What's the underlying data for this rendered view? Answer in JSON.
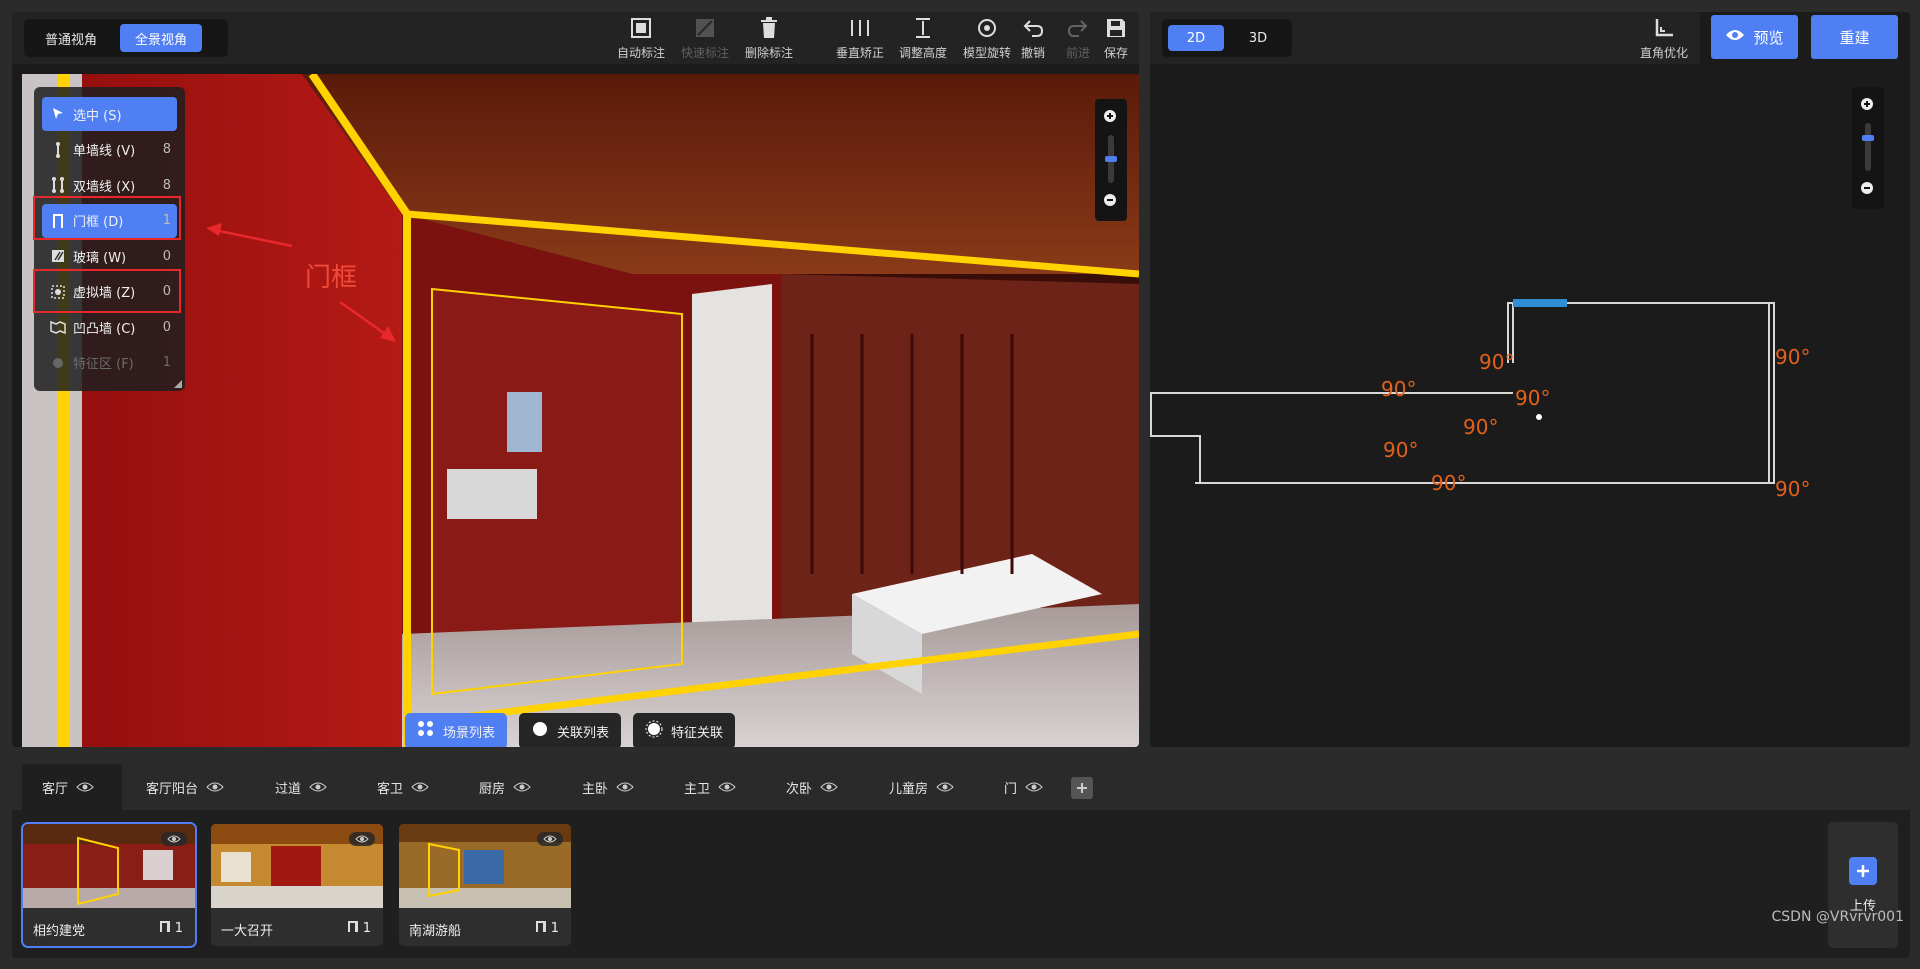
{
  "view_toggle": {
    "normal": "普通视角",
    "panorama": "全景视角",
    "active": "panorama"
  },
  "toolbar": [
    {
      "label": "自动标注",
      "icon": "auto-mark-icon",
      "enabled": true
    },
    {
      "label": "快速标注",
      "icon": "quick-mark-icon",
      "enabled": false
    },
    {
      "label": "删除标注",
      "icon": "trash-icon",
      "enabled": true
    },
    {
      "label": "垂直矫正",
      "icon": "vertical-correct-icon",
      "enabled": true
    },
    {
      "label": "调整高度",
      "icon": "adjust-height-icon",
      "enabled": true
    },
    {
      "label": "模型旋转",
      "icon": "rotate-icon",
      "enabled": true
    },
    {
      "label": "撤销",
      "icon": "undo-icon",
      "enabled": true
    },
    {
      "label": "前进",
      "icon": "redo-icon",
      "enabled": false
    },
    {
      "label": "保存",
      "icon": "save-icon",
      "enabled": true
    }
  ],
  "palette": [
    {
      "label": "选中 (S)",
      "count": "",
      "icon": "cursor-icon",
      "active": true,
      "enabled": true
    },
    {
      "label": "单墙线 (V)",
      "count": "8",
      "icon": "single-wall-icon",
      "active": false,
      "enabled": true
    },
    {
      "label": "双墙线 (X)",
      "count": "8",
      "icon": "double-wall-icon",
      "active": false,
      "enabled": true
    },
    {
      "label": "门框 (D)",
      "count": "1",
      "icon": "door-frame-icon",
      "active": true,
      "enabled": true
    },
    {
      "label": "玻璃 (W)",
      "count": "0",
      "icon": "glass-icon",
      "active": false,
      "enabled": true
    },
    {
      "label": "虚拟墙 (Z)",
      "count": "0",
      "icon": "virtual-wall-icon",
      "active": false,
      "enabled": true
    },
    {
      "label": "凹凸墙 (C)",
      "count": "0",
      "icon": "bump-wall-icon",
      "active": false,
      "enabled": true
    },
    {
      "label": "特征区 (F)",
      "count": "1",
      "icon": "feature-area-icon",
      "active": false,
      "enabled": false
    }
  ],
  "annotation": {
    "label": "门框"
  },
  "pano_buttons": [
    {
      "label": "场景列表",
      "icon": "scene-list-icon",
      "active": true
    },
    {
      "label": "关联列表",
      "icon": "link-list-icon",
      "active": false
    },
    {
      "label": "特征关联",
      "icon": "feature-link-icon",
      "active": false
    }
  ],
  "right": {
    "dim_toggle": {
      "two_d": "2D",
      "three_d": "3D",
      "active": "2D"
    },
    "optimize_label": "直角优化",
    "preview_label": "预览",
    "rebuild_label": "重建"
  },
  "floorplan": {
    "angle_labels": [
      "90°",
      "90°",
      "90°",
      "90°",
      "90°",
      "90°",
      "90°",
      "90°"
    ]
  },
  "room_tabs": [
    "客厅",
    "客厅阳台",
    "过道",
    "客卫",
    "厨房",
    "主卧",
    "主卫",
    "次卧",
    "儿童房",
    "门"
  ],
  "active_tab": "客厅",
  "scenes": [
    {
      "name": "相约建党",
      "count": "1",
      "active": true
    },
    {
      "name": "一大召开",
      "count": "1",
      "active": false
    },
    {
      "name": "南湖游船",
      "count": "1",
      "active": false
    }
  ],
  "upload_label": "上传",
  "watermark": "CSDN @VRvrvr001",
  "colors": {
    "accent": "#4f7ff2",
    "annotation_red": "#e8282b",
    "angle_orange": "#e2611b",
    "wall_yellow": "#ffd200"
  }
}
